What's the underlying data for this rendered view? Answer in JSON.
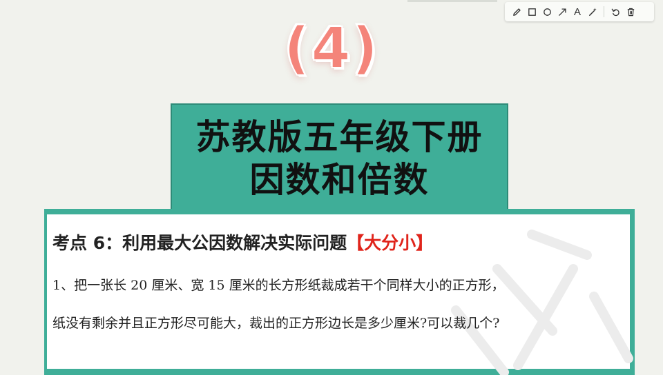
{
  "toolbar": {
    "tools": [
      {
        "name": "pen-icon"
      },
      {
        "name": "rectangle-icon"
      },
      {
        "name": "circle-icon"
      },
      {
        "name": "arrow-icon"
      },
      {
        "name": "text-icon",
        "glyph": "A"
      },
      {
        "name": "magic-wand-icon"
      },
      {
        "name": "undo-icon"
      },
      {
        "name": "trash-icon"
      }
    ]
  },
  "episode_number": "(4)",
  "title": {
    "line1": "苏教版五年级下册",
    "line2": "因数和倍数"
  },
  "card": {
    "heading": "考点 6：利用最大公因数解决实际问题",
    "heading_tag": "【大分小】",
    "problem_line1": "1、把一张长 20 厘米、宽 15 厘米的长方形纸裁成若干个同样大小的正方形，",
    "problem_line2": "纸没有剩余并且正方形尽可能大，裁出的正方形边长是多少厘米?可以裁几个?"
  },
  "colors": {
    "accent_teal": "#3fae98",
    "number_pink": "#f4847a",
    "tag_red": "#e0241b",
    "background": "#f1f2ed"
  }
}
